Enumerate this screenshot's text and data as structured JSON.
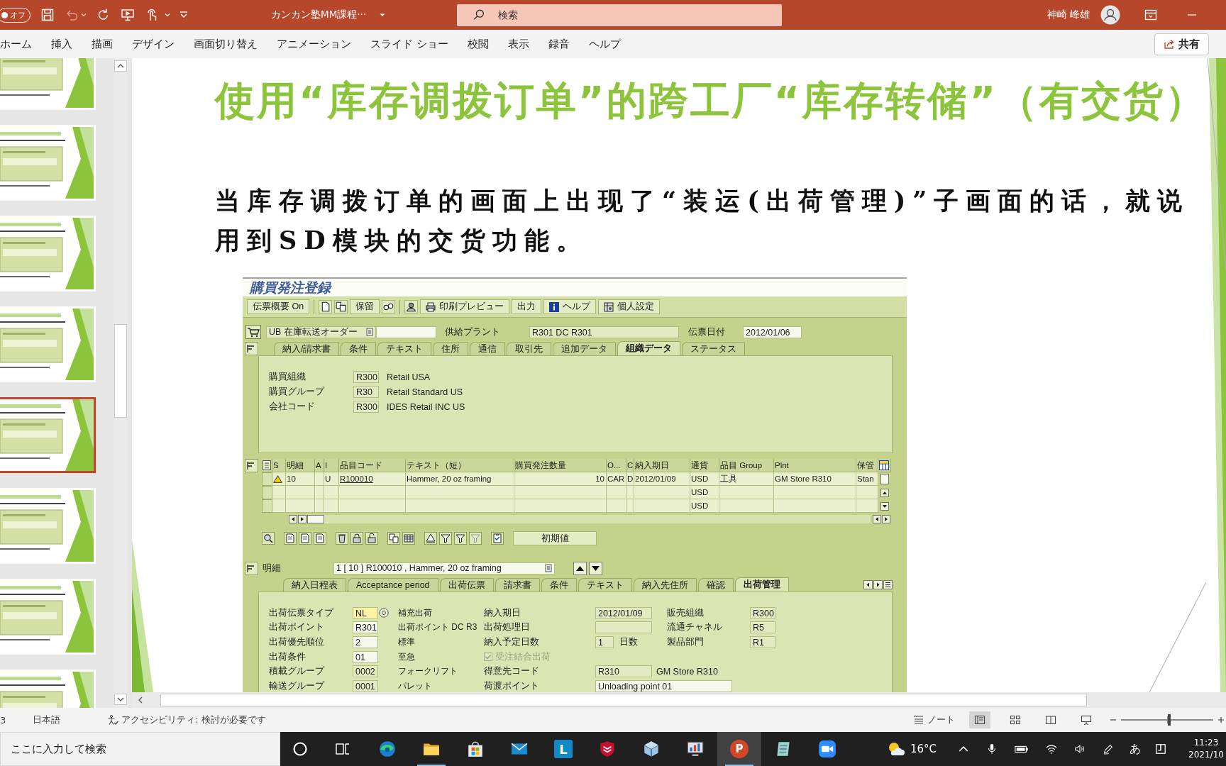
{
  "titlebar": {
    "autosave": {
      "label": "オフ",
      "on": false
    },
    "quick_access": [
      {
        "kind": "save",
        "disabled": false
      },
      {
        "kind": "undo",
        "disabled": true
      },
      {
        "kind": "redo",
        "disabled": false
      },
      {
        "kind": "present",
        "disabled": false
      },
      {
        "kind": "touch",
        "disabled": false
      }
    ],
    "document_title": "カンカン塾MM課程···",
    "search": {
      "placeholder": "検索"
    },
    "user_name": "神崎 峰雄"
  },
  "ribbon": {
    "tabs": [
      {
        "label": "ホーム",
        "selected": false
      },
      {
        "label": "挿入",
        "selected": false
      },
      {
        "label": "描画",
        "selected": false
      },
      {
        "label": "デザイン",
        "selected": false
      },
      {
        "label": "画面切り替え",
        "selected": false
      },
      {
        "label": "アニメーション",
        "selected": false
      },
      {
        "label": "スライド ショー",
        "selected": false
      },
      {
        "label": "校閲",
        "selected": false
      },
      {
        "label": "表示",
        "selected": false
      },
      {
        "label": "録音",
        "selected": false
      },
      {
        "label": "ヘルプ",
        "selected": false
      }
    ],
    "share": "共有"
  },
  "thumbnails": [
    {
      "selected": false
    },
    {
      "selected": false
    },
    {
      "selected": false
    },
    {
      "selected": false
    },
    {
      "selected": true
    },
    {
      "selected": false
    },
    {
      "selected": false
    },
    {
      "selected": false
    }
  ],
  "slide": {
    "title": "使用“库存调拨订单”的跨工厂“库存转储”（有交货）",
    "lines": [
      "当库存调拨订单的画面上出现了“装运(出荷管理)”子画面的话，就说",
      "用到SD模块的交货功能。"
    ],
    "sap": {
      "title": "購買発注登録",
      "toolbar": [
        "伝票概要 On",
        "保留",
        "印刷プレビュー",
        "出力",
        "ヘルプ",
        "個人設定"
      ],
      "header": {
        "doc_type": "UB 在庫転送オーダー",
        "plant_label": "供給プラント",
        "plant": "R301 DC R301",
        "date_label": "伝票日付",
        "date": "2012/01/06"
      },
      "tabs": [
        {
          "label": "納入/請求書",
          "selected": false
        },
        {
          "label": "条件",
          "selected": false
        },
        {
          "label": "テキスト",
          "selected": false
        },
        {
          "label": "住所",
          "selected": false
        },
        {
          "label": "通信",
          "selected": false
        },
        {
          "label": "取引先",
          "selected": false
        },
        {
          "label": "追加データ",
          "selected": false
        },
        {
          "label": "組織データ",
          "selected": true
        },
        {
          "label": "ステータス",
          "selected": false
        }
      ],
      "org_rows": [
        {
          "label": "購買組織",
          "value": "R300",
          "text": "Retail USA"
        },
        {
          "label": "購買グループ",
          "value": "R30",
          "text": "Retail Standard US"
        },
        {
          "label": "会社コード",
          "value": "R300",
          "text": "IDES Retail INC US"
        }
      ],
      "table": {
        "columns": [
          "S",
          "明細",
          "A",
          "I",
          "品目コード",
          "テキスト（短）",
          "購買発注数量",
          "O...",
          "C",
          "納入期日",
          "通貨",
          "品目 Group",
          "Plnt",
          "保管"
        ],
        "rows": [
          {
            "warning": true,
            "cells": [
              null,
              "10",
              null,
              "U",
              "R100010",
              "Hammer, 20 oz framing",
              "10",
              "CAR",
              "D",
              "2012/01/09",
              "USD",
              "工具",
              "GM Store R310",
              "Stan"
            ]
          },
          {
            "warning": false,
            "cells": [
              null,
              null,
              null,
              null,
              null,
              null,
              null,
              null,
              null,
              null,
              "USD",
              null,
              null,
              null
            ]
          },
          {
            "warning": false,
            "cells": [
              null,
              null,
              null,
              null,
              null,
              null,
              null,
              null,
              null,
              null,
              "USD",
              null,
              null,
              null
            ]
          }
        ]
      },
      "table_button": "初期値",
      "detail": {
        "label": "明細",
        "item": "1 [ 10 ] R100010 , Hammer, 20 oz framing",
        "tabs": [
          {
            "label": "納入日程表",
            "selected": false
          },
          {
            "label": "Acceptance period",
            "selected": false
          },
          {
            "label": "出荷伝票",
            "selected": false
          },
          {
            "label": "請求書",
            "selected": false
          },
          {
            "label": "条件",
            "selected": false
          },
          {
            "label": "テキスト",
            "selected": false
          },
          {
            "label": "納入先住所",
            "selected": false
          },
          {
            "label": "確認",
            "selected": false
          },
          {
            "label": "出荷管理",
            "selected": true
          }
        ],
        "rows": [
          {
            "left": {
              "label": "出荷伝票タイプ",
              "value": "NL",
              "editable": true,
              "focused": true
            },
            "note": "補充出荷",
            "middle": {
              "kind": "field",
              "label": "納入期日",
              "value": "2012/01/09",
              "editable": false
            },
            "right": {
              "label": "販売組織",
              "value": "R300"
            }
          },
          {
            "left": {
              "label": "出荷ポイント",
              "value": "R301",
              "editable": true,
              "focused": false
            },
            "note": "出荷ポイント DC R3",
            "middle": {
              "kind": "field",
              "label": "出荷処理日",
              "editable": false
            },
            "right": {
              "label": "流通チャネル",
              "value": "R5"
            }
          },
          {
            "left": {
              "label": "出荷優先順位",
              "value": "2",
              "editable": true,
              "focused": false
            },
            "note": "標準",
            "middle": {
              "kind": "field",
              "label": "納入予定日数",
              "value": "1",
              "unit": "日数",
              "editable": false
            },
            "right": {
              "label": "製品部門",
              "value": "R1"
            }
          },
          {
            "left": {
              "label": "出荷条件",
              "value": "01",
              "editable": true,
              "focused": false
            },
            "note": "至急",
            "middle": {
              "kind": "checkbox",
              "label": "受注結合出荷",
              "checked": true,
              "disabled": true
            }
          },
          {
            "left": {
              "label": "積載グループ",
              "value": "0002",
              "editable": false,
              "focused": false
            },
            "note": "フォークリフト",
            "middle": {
              "kind": "field",
              "label": "得意先コード",
              "value": "R310",
              "text": "GM Store R310",
              "editable": false
            }
          },
          {
            "left": {
              "label": "輸送グループ",
              "value": "0001",
              "editable": false,
              "focused": false
            },
            "note": "パレット",
            "middle": {
              "kind": "field",
              "label": "荷渡ポイント",
              "value": "Unloading point 01",
              "editable": true
            }
          }
        ]
      }
    }
  },
  "status_bar": {
    "slide_info": "3",
    "language": "日本語",
    "accessibility": "アクセシビリティ: 検討が必要です",
    "notes": "ノート",
    "views": [
      {
        "kind": "normal",
        "selected": true
      },
      {
        "kind": "sorter",
        "selected": false
      },
      {
        "kind": "reading",
        "selected": false
      },
      {
        "kind": "slideshow",
        "selected": false
      }
    ],
    "zoom": {
      "level": 0.52
    }
  },
  "taskbar": {
    "search": {
      "placeholder": "ここに入力して検索"
    },
    "apps": [
      {
        "kind": "browser",
        "open": false,
        "selected": false
      },
      {
        "kind": "folder",
        "open": true,
        "selected": false
      },
      {
        "kind": "store",
        "open": false,
        "selected": false
      },
      {
        "kind": "mail",
        "open": false,
        "selected": false
      },
      {
        "kind": "launcher",
        "label": "L",
        "open": false,
        "selected": false
      },
      {
        "kind": "shield",
        "open": false,
        "selected": false
      },
      {
        "kind": "cube",
        "open": false,
        "selected": false
      },
      {
        "kind": "monitor",
        "open": false,
        "selected": false
      },
      {
        "kind": "slides",
        "label": "P",
        "open": true,
        "selected": true
      },
      {
        "kind": "notes",
        "open": false,
        "selected": false
      },
      {
        "kind": "camera",
        "open": false,
        "selected": false
      }
    ],
    "weather": "16°C",
    "ime": "あ",
    "time": "11:23",
    "date": "2021/10"
  }
}
